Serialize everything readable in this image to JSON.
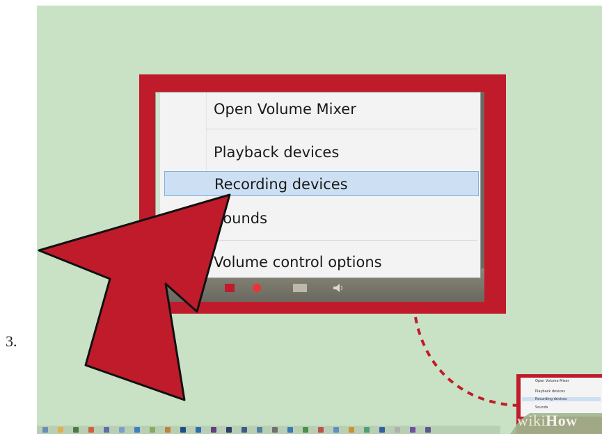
{
  "step": {
    "number": "3."
  },
  "context_menu": {
    "items": [
      {
        "label": "Open Volume Mixer"
      },
      {
        "label": "Playback devices"
      },
      {
        "label": "Recording devices",
        "highlighted": true
      },
      {
        "label": "Sounds"
      },
      {
        "label": "Volume control options"
      }
    ]
  },
  "mini_menu": {
    "items": [
      {
        "label": "Open Volume Mixer"
      },
      {
        "label": "Playback devices"
      },
      {
        "label": "Recording devices",
        "highlighted": true
      },
      {
        "label": "Sounds"
      }
    ]
  },
  "watermark": {
    "wiki": "wiki",
    "how": "How"
  },
  "icons": {
    "arrow": "pointer-arrow-icon",
    "speaker": "speaker-icon",
    "network": "network-icon",
    "flag": "action-center-icon"
  },
  "colors": {
    "background": "#c9e2c5",
    "frame": "#c01b2b",
    "highlight": "#cde0f3",
    "highlight_border": "#7fb0df"
  }
}
